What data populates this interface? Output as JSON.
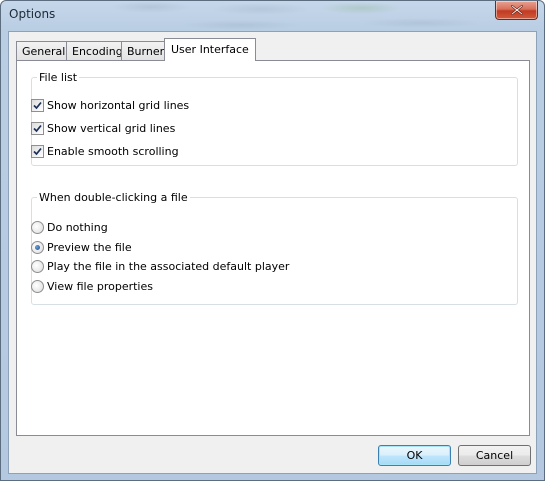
{
  "window": {
    "title": "Options"
  },
  "tabs": [
    {
      "label": "General",
      "active": false
    },
    {
      "label": "Encoding",
      "active": false
    },
    {
      "label": "Burner",
      "active": false
    },
    {
      "label": "User Interface",
      "active": true
    }
  ],
  "file_list": {
    "legend": "File list",
    "options": [
      {
        "label": "Show horizontal grid lines",
        "checked": true
      },
      {
        "label": "Show vertical grid lines",
        "checked": true
      },
      {
        "label": "Enable smooth scrolling",
        "checked": true
      }
    ]
  },
  "double_click": {
    "legend": "When double-clicking a file",
    "options": [
      {
        "label": "Do nothing",
        "selected": false
      },
      {
        "label": "Preview the file",
        "selected": true
      },
      {
        "label": "Play the file in the associated default player",
        "selected": false
      },
      {
        "label": "View file properties",
        "selected": false
      }
    ]
  },
  "buttons": {
    "ok_label": "OK",
    "cancel_label": "Cancel"
  },
  "colors": {
    "titlebar": "#b9cde3",
    "close_button": "#c13b22",
    "default_button_border": "#3c7fb1"
  }
}
